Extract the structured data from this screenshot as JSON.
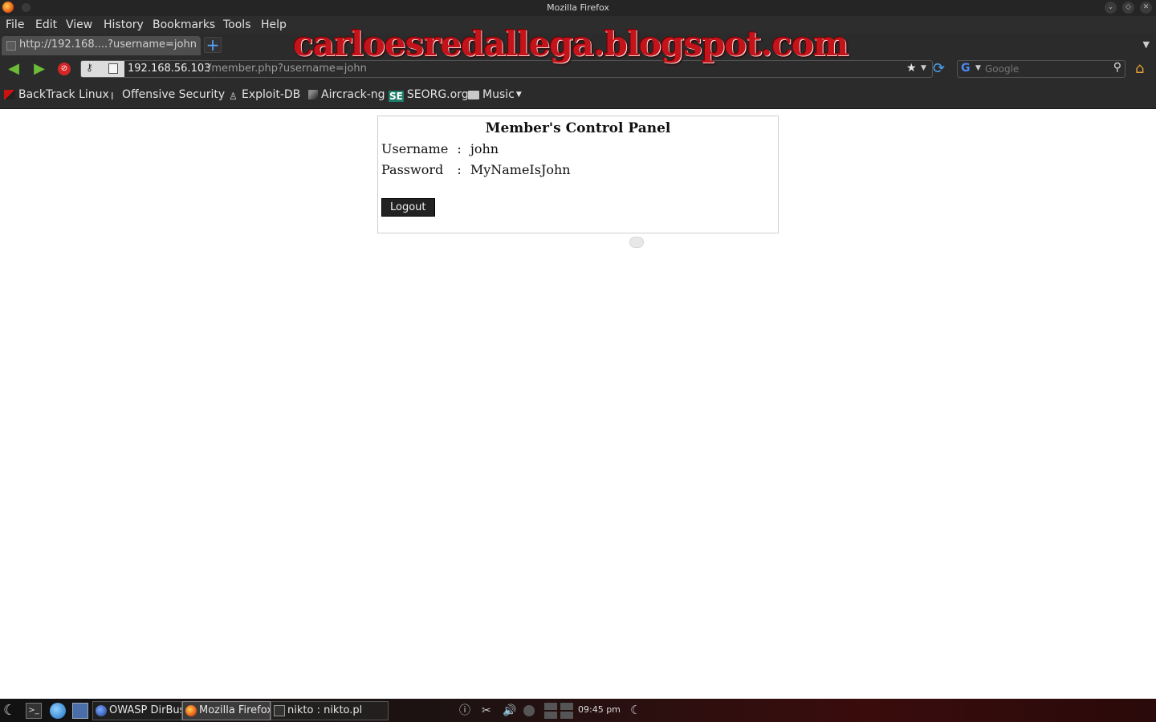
{
  "window": {
    "title": "Mozilla Firefox"
  },
  "menu": [
    "File",
    "Edit",
    "View",
    "History",
    "Bookmarks",
    "Tools",
    "Help"
  ],
  "tab": {
    "title": "http://192.168....?username=john"
  },
  "banner": "carloesredallega.blogspot.com",
  "address": {
    "host": "192.168.56.103",
    "path": "/member.php?username=john"
  },
  "search": {
    "placeholder": "Google"
  },
  "bookmarks": [
    "BackTrack Linux",
    "Offensive Security",
    "Exploit-DB",
    "Aircrack-ng",
    "SEORG.org",
    "Music"
  ],
  "bookmark_icons": {
    "seorg": "SE"
  },
  "panel": {
    "title": "Member's Control Panel",
    "username_label": "Username",
    "username_value": "john",
    "password_label": "Password",
    "password_value": "MyNameIsJohn",
    "separator": ":",
    "logout_label": "Logout"
  },
  "taskbar": {
    "tasks": [
      "OWASP DirBus",
      "Mozilla Firefox",
      "nikto : nikto.pl"
    ],
    "clock": "09:45 pm"
  },
  "colors": {
    "accent_red": "#c3141b",
    "nav_green": "#6bbd38",
    "reload_blue": "#4aa3f0"
  }
}
